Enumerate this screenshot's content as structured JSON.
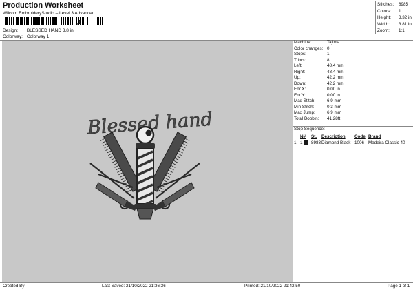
{
  "header": {
    "title": "Production Worksheet",
    "subtitle": "Wilcom EmbroideryStudio – Level 3 Advanced",
    "barcode_suffix": ",1"
  },
  "design_meta": [
    {
      "label": "Design:",
      "value": "BLESSED HAND 3,8 in"
    },
    {
      "label": "Colorway:",
      "value": "Colorway 1"
    }
  ],
  "stats": [
    {
      "label": "Stitches:",
      "value": "8985"
    },
    {
      "label": "Colors:",
      "value": "1"
    },
    {
      "label": "Height:",
      "value": "3.32 in"
    },
    {
      "label": "Width:",
      "value": "3.81 in"
    },
    {
      "label": "Zoom:",
      "value": "1:1"
    }
  ],
  "machine_info": [
    {
      "label": "Machine:",
      "value": "Tajima"
    },
    {
      "label": "Color changes:",
      "value": "0"
    },
    {
      "label": "Stops:",
      "value": "1"
    },
    {
      "label": "Trims:",
      "value": "8"
    },
    {
      "label": "Left:",
      "value": "48.4 mm"
    },
    {
      "label": "Right:",
      "value": "48.4 mm"
    },
    {
      "label": "Up:",
      "value": "42.2 mm"
    },
    {
      "label": "Down:",
      "value": "42.2 mm"
    },
    {
      "label": "EndX:",
      "value": "0.00 in"
    },
    {
      "label": "EndY:",
      "value": "0.00 in"
    },
    {
      "label": "Max Stitch:",
      "value": "6.9 mm"
    },
    {
      "label": "Min Stitch:",
      "value": "0.3 mm"
    },
    {
      "label": "Max Jump:",
      "value": "6.9 mm"
    },
    {
      "label": "Total Bobbin:",
      "value": "41.28ft"
    }
  ],
  "stop_sequence": {
    "heading": "Stop Sequence:",
    "columns": [
      "N#",
      "St.",
      "Description",
      "Code",
      "Brand"
    ],
    "rows": [
      {
        "stop": "1.",
        "n": "1",
        "st": "8983",
        "description": "Diamond Black",
        "code": "1006",
        "brand": "Madeira Classic 40",
        "color": "#1a1a1a"
      }
    ]
  },
  "design_preview": {
    "text": "Blessed hand",
    "background": "#c8c8c8",
    "thread_color": "#3a3a3a"
  },
  "footer": {
    "created_by": "Created By:",
    "last_saved": "Last Saved: 21/10/2022 21:36:36",
    "printed": "Printed: 21/10/2022 21:42:50",
    "page": "Page 1 of 1"
  }
}
